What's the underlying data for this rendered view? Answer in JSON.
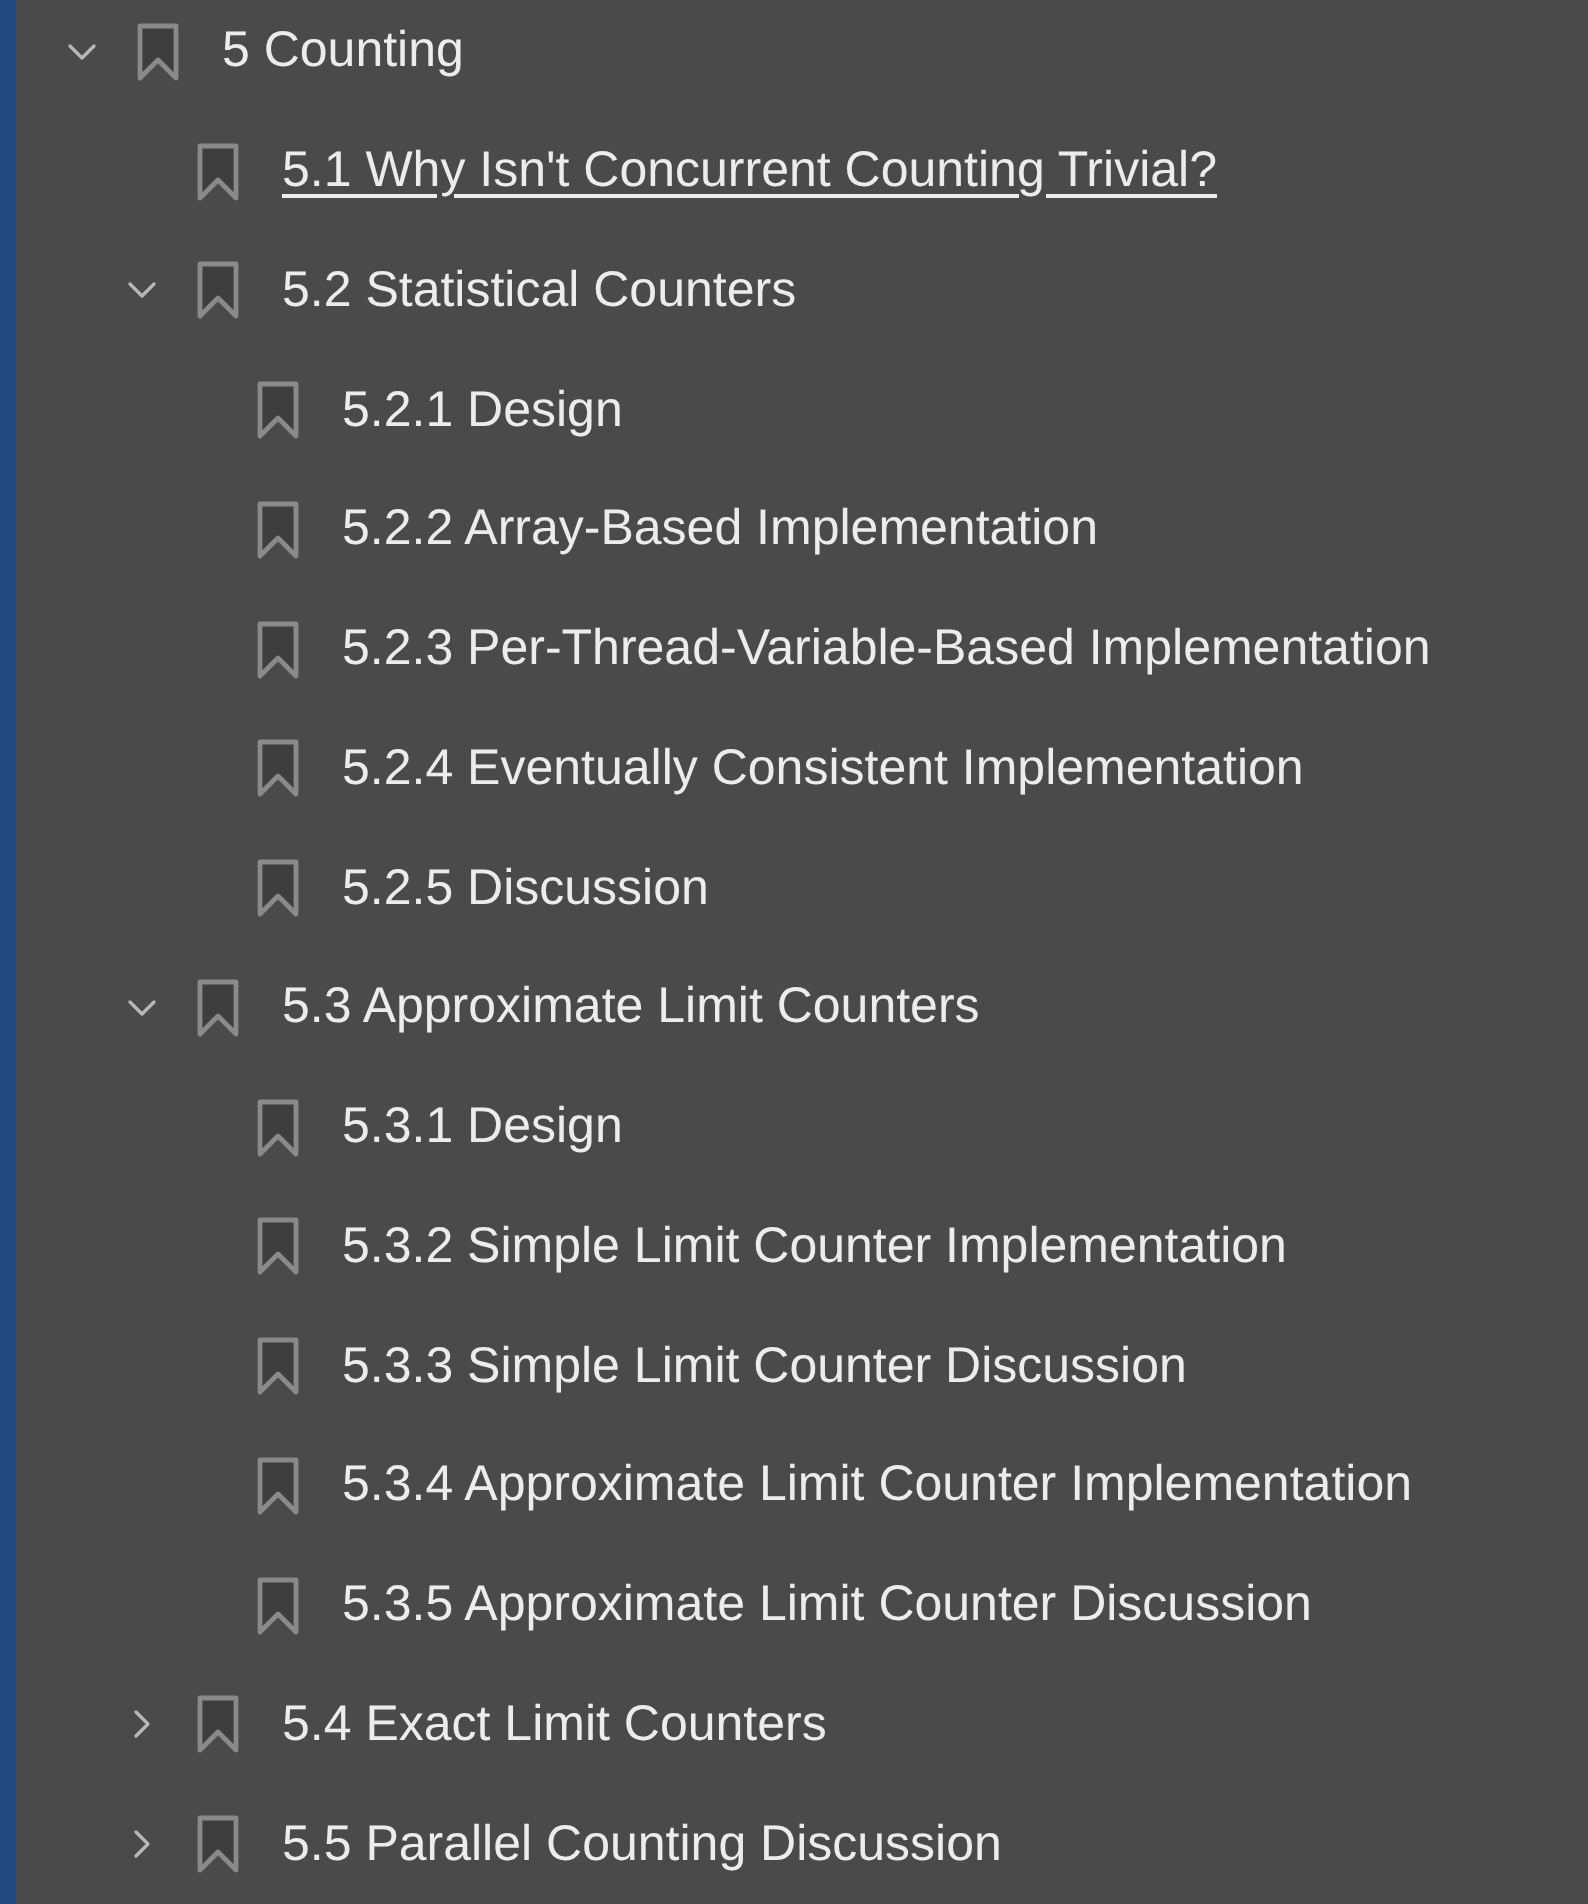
{
  "outline": [
    {
      "title": "5 Counting",
      "expanded": true,
      "hovered": false,
      "children": [
        {
          "title": "5.1 Why Isn't Concurrent Counting Trivial?",
          "hovered": true
        },
        {
          "title": "5.2 Statistical Counters",
          "expanded": true,
          "hovered": false,
          "children": [
            {
              "title": "5.2.1 Design",
              "hovered": false
            },
            {
              "title": "5.2.2 Array-Based Implementation",
              "hovered": false
            },
            {
              "title": "5.2.3 Per-Thread-Variable-Based Implementation",
              "hovered": false
            },
            {
              "title": "5.2.4 Eventually Consistent Implementation",
              "hovered": false
            },
            {
              "title": "5.2.5 Discussion",
              "hovered": false
            }
          ]
        },
        {
          "title": "5.3 Approximate Limit Counters",
          "expanded": true,
          "hovered": false,
          "children": [
            {
              "title": "5.3.1 Design",
              "hovered": false
            },
            {
              "title": "5.3.2 Simple Limit Counter Implementation",
              "hovered": false
            },
            {
              "title": "5.3.3 Simple Limit Counter Discussion",
              "hovered": false
            },
            {
              "title": "5.3.4 Approximate Limit Counter Implementation",
              "hovered": false
            },
            {
              "title": "5.3.5 Approximate Limit Counter Discussion",
              "hovered": false
            }
          ]
        },
        {
          "title": "5.4 Exact Limit Counters",
          "expanded": false,
          "hovered": false
        },
        {
          "title": "5.5 Parallel Counting Discussion",
          "expanded": false,
          "hovered": false
        }
      ]
    }
  ]
}
